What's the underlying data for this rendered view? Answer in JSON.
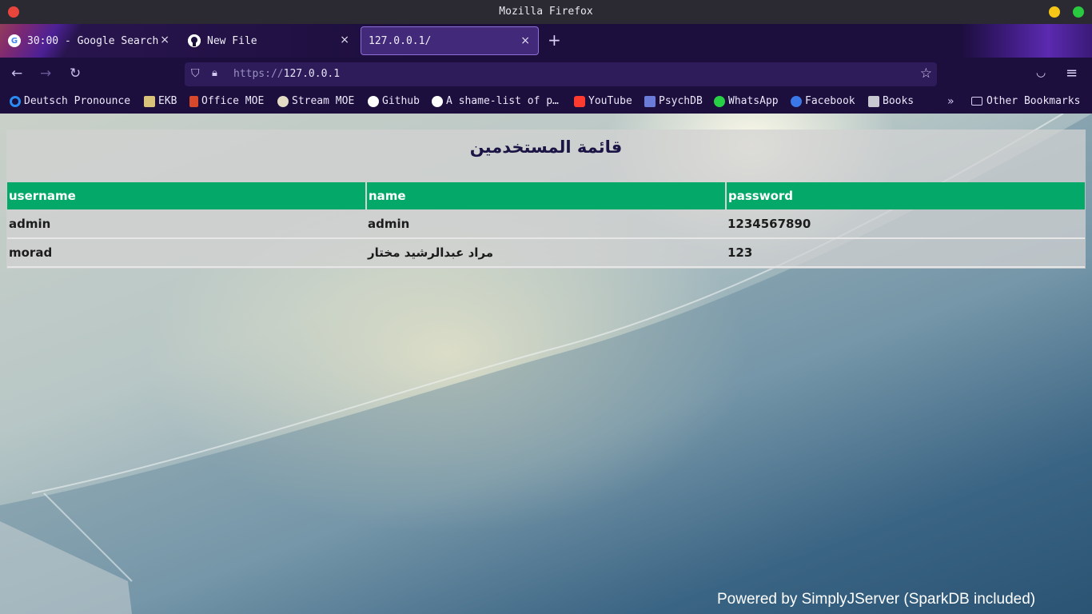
{
  "window": {
    "title": "Mozilla Firefox"
  },
  "tabs": [
    {
      "label": "30:00 - Google Search",
      "favicon": "google-icon",
      "active": false
    },
    {
      "label": "New File",
      "favicon": "github-icon",
      "active": false
    },
    {
      "label": "127.0.0.1/",
      "favicon": "",
      "active": true
    }
  ],
  "tab_close_glyph": "×",
  "new_tab_glyph": "+",
  "address": {
    "protocol": "https://",
    "host": "127.0.0.1"
  },
  "bookmarks": [
    {
      "label": "Deutsch Pronounce",
      "icon": "circle-blue-icon",
      "color": "#2a8bf2"
    },
    {
      "label": "EKB",
      "icon": "ekb-icon",
      "color": "#d9c27a"
    },
    {
      "label": "Office MOE",
      "icon": "office-icon",
      "color": "#d7492a"
    },
    {
      "label": "Stream MOE",
      "icon": "stream-icon",
      "color": "#e4dcc4"
    },
    {
      "label": "Github",
      "icon": "github-icon",
      "color": "#ffffff"
    },
    {
      "label": "A shame-list of p…",
      "icon": "github-icon",
      "color": "#ffffff"
    },
    {
      "label": "YouTube",
      "icon": "youtube-icon",
      "color": "#ff3b30"
    },
    {
      "label": "PsychDB",
      "icon": "psi-icon",
      "color": "#6b7cd8"
    },
    {
      "label": "WhatsApp",
      "icon": "whatsapp-icon",
      "color": "#27d045"
    },
    {
      "label": "Facebook",
      "icon": "facebook-icon",
      "color": "#3b78e7"
    },
    {
      "label": "Books",
      "icon": "books-icon",
      "color": "#c8c8d0"
    }
  ],
  "other_bookmarks": "Other Bookmarks",
  "page": {
    "title": "قائمة المستخدمين",
    "columns": [
      "username",
      "name",
      "password"
    ],
    "rows": [
      [
        "admin",
        "admin",
        "1234567890"
      ],
      [
        "morad",
        "مراد عبدالرشيد مختار",
        "123"
      ]
    ],
    "footer": "Powered by SimplyJServer (SparkDB included)"
  },
  "colors": {
    "header_green": "#04a96a",
    "title_navy": "#1b1546",
    "toolbar_purple": "#1c0e3d"
  }
}
